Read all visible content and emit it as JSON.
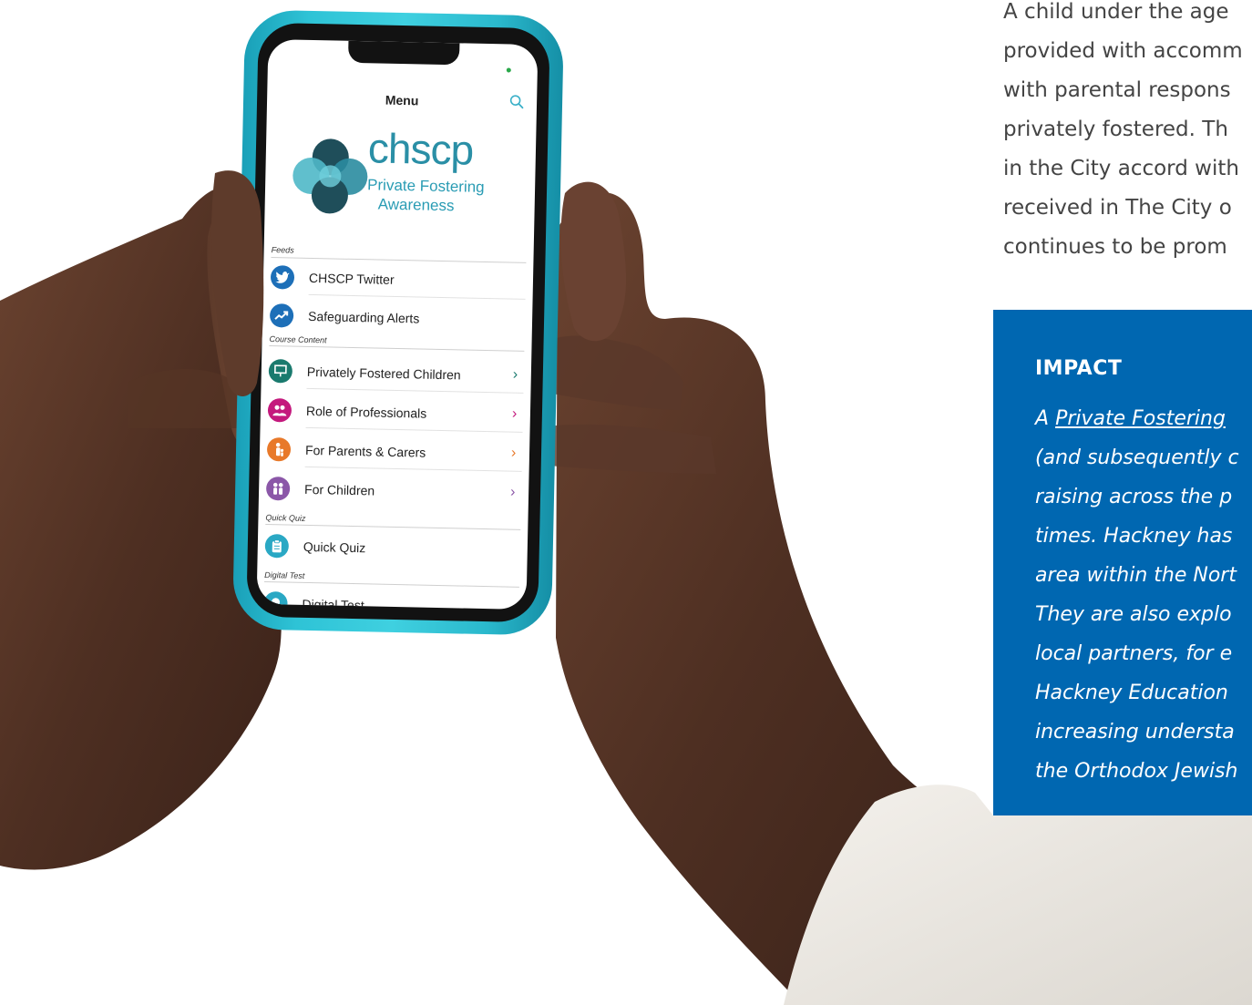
{
  "body_text": {
    "lines": [
      "A child under the age",
      "provided with accomm",
      "with parental respons",
      "privately fostered.  Th",
      "in the City accord with",
      "received in The City o",
      "continues to be prom"
    ]
  },
  "impact": {
    "heading": "IMPACT",
    "link_text": "Private Fostering",
    "line1_prefix": "A",
    "lines": [
      "(and subsequently c",
      "raising across the p",
      "times.  Hackney has",
      "area within the Nort",
      "They are also explo",
      "local partners, for e",
      "Hackney Education",
      "increasing understa",
      "the Orthodox Jewish"
    ]
  },
  "app": {
    "menu_title": "Menu",
    "logo_word": "chscp",
    "logo_sub1": "Private Fostering",
    "logo_sub2": "Awareness",
    "sections": {
      "feeds": "Feeds",
      "course": "Course Content",
      "quiz": "Quick Quiz",
      "test": "Digital Test"
    },
    "items": {
      "twitter": "CHSCP Twitter",
      "alerts": "Safeguarding Alerts",
      "privately": "Privately Fostered Children",
      "professionals": "Role of Professionals",
      "parents": "For Parents & Carers",
      "children": "For Children",
      "quiz": "Quick Quiz",
      "test": "Digital Test"
    },
    "colors": {
      "twitter": "#1d6fb8",
      "alerts": "#1d6fb8",
      "privately": "#1a7a6e",
      "professionals": "#c4197d",
      "parents": "#e8792a",
      "children": "#8b57a8",
      "quiz": "#2aa8c4",
      "test": "#2aa8c4"
    }
  }
}
